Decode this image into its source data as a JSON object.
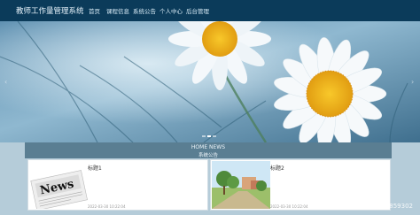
{
  "header": {
    "brand": "教师工作量管理系统",
    "nav": [
      "首页",
      "课程信息",
      "系统公告",
      "个人中心",
      "后台管理"
    ]
  },
  "banner": {
    "arrow_left": "‹",
    "arrow_right": "›",
    "slide_count": 3,
    "active_slide": 2
  },
  "section": {
    "title": "HOME NEWS",
    "subtitle": "系统公告"
  },
  "cards": [
    {
      "title": "标题1",
      "date": "2022-03-30 10:22:04",
      "thumb_text": "News"
    },
    {
      "title": "标题2",
      "date": "2022-03-30 10:22:04"
    }
  ],
  "watermark": "CSDN @qq1263859302",
  "colors": {
    "navbar": "#0b3b5a",
    "content_bg": "#b5ccd9",
    "section_head": "#5a7e92"
  }
}
